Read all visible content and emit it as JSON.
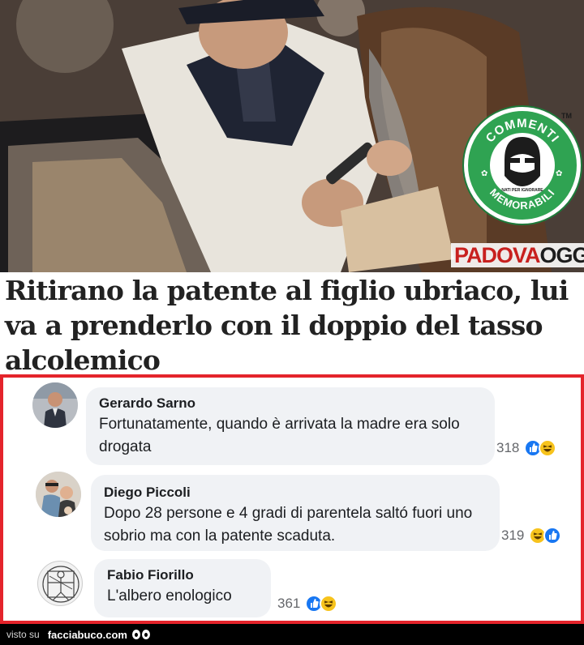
{
  "article": {
    "source_logo": {
      "part1": "PADOVA",
      "part2": "OGGI"
    },
    "sticker": {
      "top_text": "COMMENTI",
      "bottom_text": "MEMORABILI",
      "tagline": "NATI PER IGNORARE",
      "tm": "TM"
    },
    "headline": "Ritirano la patente al figlio ubriaco, lui va a prenderlo con il doppio del tasso alcolemico"
  },
  "comments": [
    {
      "author": "Gerardo Sarno",
      "text": "Fortunatamente, quando è arrivata la madre era solo drogata",
      "reaction_count": "318",
      "reactions": [
        "like-icon",
        "haha-icon"
      ]
    },
    {
      "author": "Diego Piccoli",
      "text": "Dopo 28 persone e 4 gradi di parentela saltó fuori uno sobrio ma con la patente scaduta.",
      "reaction_count": "319",
      "reactions": [
        "haha-icon",
        "like-icon"
      ]
    },
    {
      "author": "Fabio Fiorillo",
      "text": "L'albero enologico",
      "reaction_count": "361",
      "reactions": [
        "like-icon",
        "haha-icon"
      ]
    }
  ],
  "footer": {
    "seen_on": "visto su",
    "site": "facciabuco.com"
  },
  "colors": {
    "frame_red": "#e4242b",
    "sticker_green": "#2fa352",
    "like_blue": "#1877f2",
    "haha_yellow": "#f7c31c"
  }
}
